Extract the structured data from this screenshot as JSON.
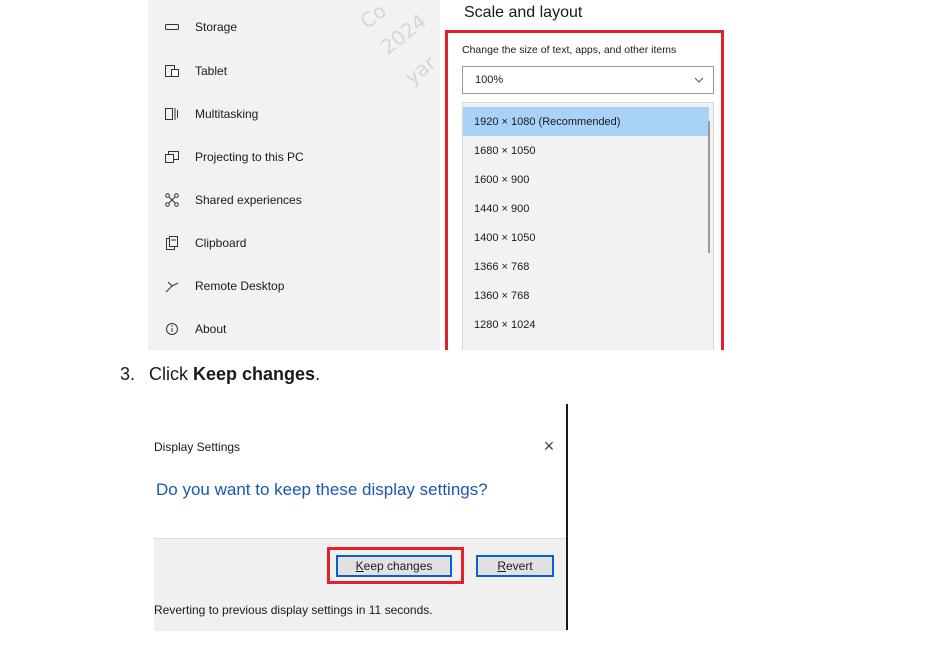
{
  "settings": {
    "nav_items": [
      {
        "label": "Storage",
        "icon": "storage-icon"
      },
      {
        "label": "Tablet",
        "icon": "tablet-icon"
      },
      {
        "label": "Multitasking",
        "icon": "multitasking-icon"
      },
      {
        "label": "Projecting to this PC",
        "icon": "projecting-icon"
      },
      {
        "label": "Shared experiences",
        "icon": "shared-experiences-icon"
      },
      {
        "label": "Clipboard",
        "icon": "clipboard-icon"
      },
      {
        "label": "Remote Desktop",
        "icon": "remote-desktop-icon"
      },
      {
        "label": "About",
        "icon": "info-icon"
      }
    ],
    "watermark_lines": [
      "Co",
      "2024",
      "yar"
    ],
    "section_title": "Scale and layout",
    "scale_label": "Change the size of text, apps, and other items",
    "scale_value": "100%",
    "resolutions": [
      "1920 × 1080 (Recommended)",
      "1680 × 1050",
      "1600 × 900",
      "1440 × 900",
      "1400 × 1050",
      "1366 × 768",
      "1360 × 768",
      "1280 × 1024"
    ],
    "selected_resolution_index": 0,
    "highlight_color": "#e3212b",
    "selection_color": "#a8d2f7"
  },
  "step": {
    "number": "3.",
    "prefix": "Click ",
    "action": "Keep changes",
    "suffix": "."
  },
  "dialog": {
    "title": "Display Settings",
    "close_glyph": "×",
    "question": "Do you want to keep these display settings?",
    "keep_button": {
      "mnemonic": "K",
      "rest": "eep changes"
    },
    "revert_button": {
      "mnemonic": "R",
      "rest": "evert"
    },
    "footnote": "Reverting to previous display settings in 11 seconds.",
    "question_color": "#1a56b4"
  }
}
